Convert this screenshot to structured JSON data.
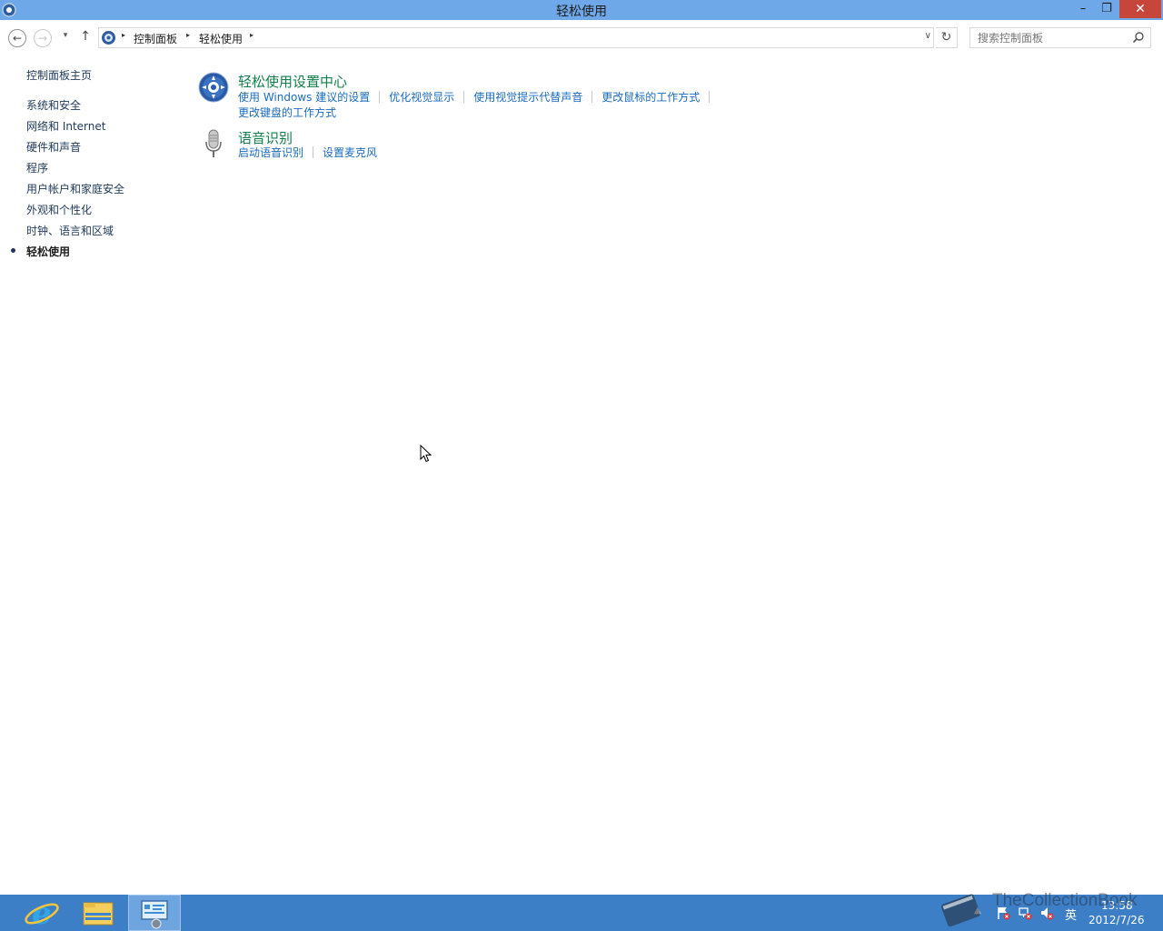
{
  "window": {
    "title": "轻松使用",
    "minimize": "–",
    "maximize": "❐",
    "close": "✕"
  },
  "nav": {
    "back": "←",
    "forward": "→",
    "recent": "▾",
    "up": "↑"
  },
  "address": {
    "crumbs": [
      "控制面板",
      "轻松使用"
    ],
    "separator": "▸",
    "dropdown": "∨",
    "refresh": "↻"
  },
  "search": {
    "placeholder": "搜索控制面板"
  },
  "sidebar": {
    "home": "控制面板主页",
    "items": [
      {
        "label": "系统和安全"
      },
      {
        "label": "网络和 Internet"
      },
      {
        "label": "硬件和声音"
      },
      {
        "label": "程序"
      },
      {
        "label": "用户帐户和家庭安全"
      },
      {
        "label": "外观和个性化"
      },
      {
        "label": "时钟、语言和区域"
      },
      {
        "label": "轻松使用",
        "active": true
      }
    ]
  },
  "categories": [
    {
      "title": "轻松使用设置中心",
      "icon": "ease-of-access-icon",
      "links": [
        "使用 Windows 建议的设置",
        "优化视觉显示",
        "使用视觉提示代替声音",
        "更改鼠标的工作方式",
        "更改键盘的工作方式"
      ]
    },
    {
      "title": "语音识别",
      "icon": "microphone-icon",
      "links": [
        "启动语音识别",
        "设置麦克风"
      ]
    }
  ],
  "taskbar": {
    "apps": [
      "internet-explorer-icon",
      "file-explorer-icon",
      "control-panel-icon"
    ],
    "tray_arrow": "▲",
    "ime": "英",
    "time": "13:58",
    "date": "2012/7/26"
  },
  "watermark": "TheCollectionBook",
  "colors": {
    "titlebar": "#6fa8e8",
    "link": "#1a6bbf",
    "category_title": "#12804b",
    "taskbar": "#3d7fc7",
    "close": "#c7463b"
  }
}
